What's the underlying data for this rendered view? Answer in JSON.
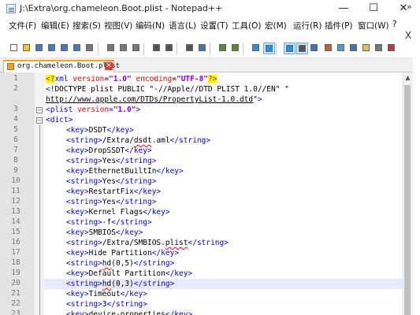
{
  "window": {
    "title": "J:\\Extra\\org.chameleon.Boot.plist - Notepad++",
    "minimize_glyph": "—",
    "maximize_glyph": "☐",
    "close_glyph": "✕"
  },
  "menu": {
    "items": [
      "文件(F)",
      "编辑(E)",
      "搜索(S)",
      "视图(V)",
      "编码(N)",
      "语言(L)",
      "设置(T)",
      "工具(O)",
      "宏(M)",
      "运行(R)",
      "插件(P)",
      "窗口(W)",
      "?"
    ],
    "close_doc_glyph": "X"
  },
  "toolbar": {
    "icons": [
      "new-file-icon",
      "open-file-icon",
      "save-icon",
      "save-all-icon",
      "close-icon",
      "close-all-icon",
      "print-icon",
      "cut-icon",
      "copy-icon",
      "paste-icon",
      "undo-icon",
      "redo-icon",
      "find-icon",
      "replace-icon",
      "zoom-in-icon",
      "zoom-out-icon",
      "sync-vertical-icon",
      "sync-horizontal-icon",
      "word-wrap-icon",
      "show-all-chars-icon",
      "indent-guide-icon",
      "user-language-icon",
      "doc-map-icon",
      "function-list-icon",
      "folder-workspace-icon",
      "monitor-icon",
      "record-macro-icon"
    ],
    "overflow_glyph": "»"
  },
  "tab": {
    "label": "org.chameleon.Boot.plist",
    "close_glyph": "✕"
  },
  "editor": {
    "line_numbers": [
      "1",
      "2",
      "",
      "3",
      "4",
      "5",
      "6",
      "7",
      "8",
      "9",
      "10",
      "11",
      "12",
      "13",
      "14",
      "15",
      "16",
      "17",
      "18",
      "19",
      "20",
      "21",
      "22",
      "23"
    ],
    "current_line": "20",
    "lines": [
      "<?xml version=\"1.0\" encoding=\"UTF-8\"?>",
      "<!DOCTYPE plist PUBLIC \"-//Apple//DTD PLIST 1.0//EN\" \"",
      "http://www.apple.com/DTDs/PropertyList-1.0.dtd\">",
      "<plist version=\"1.0\">",
      "<dict>",
      "<key>DSDT</key>",
      "<string>/Extra/dsdt.aml</string>",
      "<key>DropSSDT</key>",
      "<string>Yes</string>",
      "<key>EthernetBuiltIn</key>",
      "<string>Yes</string>",
      "<key>RestartFix</key>",
      "<string>Yes</string>",
      "<key>Kernel Flags</key>",
      "<string>-f</string>",
      "<key>SMBIOS</key>",
      "<string>/Extra/SMBIOS.plist</string>",
      "<key>Hide Partition</key>",
      "<string>hd(0,5)</string>",
      "<key>Default Partition</key>",
      "<string>hd(0,3)</string>",
      "<key>Timeout</key>",
      "<string>3</string>",
      "<key>device-properties</key>"
    ]
  },
  "colors": {
    "tag": "#0000ff",
    "attribute": "#ff0000",
    "attribute_value": "#8000ff",
    "current_line_bg": "#e8e8ff",
    "tab_accent": "#f7a21b"
  }
}
